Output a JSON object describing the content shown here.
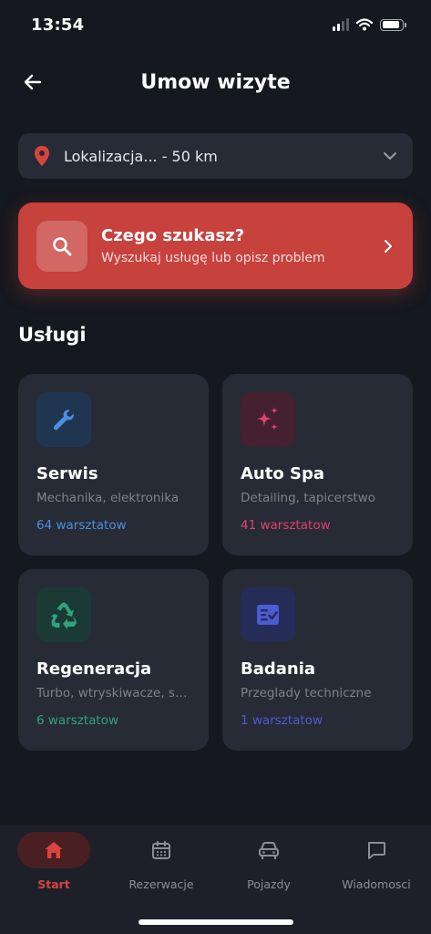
{
  "status_bar": {
    "time": "13:54",
    "battery_level": 0.9
  },
  "header": {
    "title": "Umow wizyte",
    "back_icon": "arrow-left-icon"
  },
  "location": {
    "value": "Lokalizacja... - 50 km",
    "icon": "map-pin-icon",
    "accent": "#d9443f"
  },
  "search": {
    "title": "Czego szukasz?",
    "subtitle": "Wyszukaj usługę lub opisz problem",
    "background": "#c7413d"
  },
  "services": {
    "title": "Usługi",
    "items": [
      {
        "name": "Serwis",
        "description": "Mechanika, elektronika",
        "count": "64 warsztatow",
        "icon": "wrench-icon",
        "color": "#4a90e2"
      },
      {
        "name": "Auto Spa",
        "description": "Detailing, tapicerstwo",
        "count": "41 warsztatow",
        "icon": "sparkle-icon",
        "color": "#e0406a"
      },
      {
        "name": "Regeneracja",
        "description": "Turbo, wtryskiwacze, skrzynie",
        "count": "6 warsztatow",
        "icon": "recycle-icon",
        "color": "#2fa37a"
      },
      {
        "name": "Badania",
        "description": "Przeglady techniczne",
        "count": "1 warsztatow",
        "icon": "checklist-icon",
        "color": "#4c5bd4"
      }
    ]
  },
  "nav": {
    "items": [
      {
        "label": "Start",
        "icon": "home-icon",
        "active": true
      },
      {
        "label": "Rezerwacje",
        "icon": "calendar-icon",
        "active": false
      },
      {
        "label": "Pojazdy",
        "icon": "car-icon",
        "active": false
      },
      {
        "label": "Wiadomosci",
        "icon": "chat-icon",
        "active": false
      }
    ]
  }
}
